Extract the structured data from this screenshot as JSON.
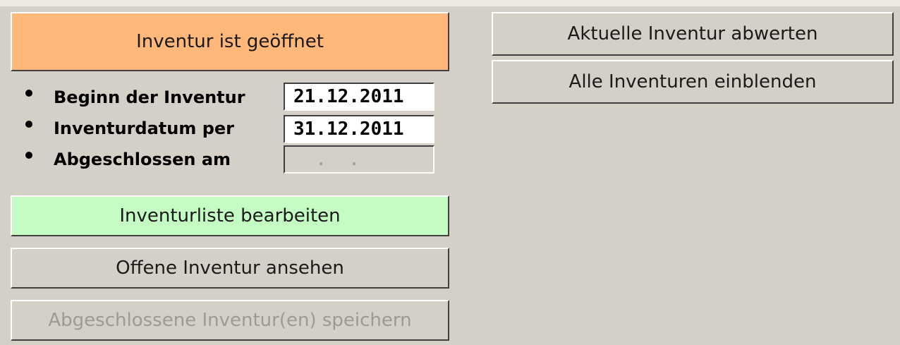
{
  "status_button": "Inventur ist geöffnet",
  "fields": [
    {
      "label": "Beginn der Inventur",
      "value": "21.12.2011"
    },
    {
      "label": "Inventurdatum per",
      "value": "31.12.2011"
    },
    {
      "label": "Abgeschlossen am",
      "value": "  .  ."
    }
  ],
  "left_buttons": {
    "edit_list": "Inventurliste bearbeiten",
    "view_open": "Offene Inventur ansehen",
    "save_closed": "Abgeschlossene Inventur(en) speichern"
  },
  "right_buttons": {
    "devalue": "Aktuelle Inventur abwerten",
    "show_all": "Alle Inventuren einblenden"
  },
  "colors": {
    "background": "#d4d0c8",
    "status_orange": "#ffb87a",
    "edit_green": "#c4fcc4",
    "disabled_text": "#9d9a94"
  }
}
